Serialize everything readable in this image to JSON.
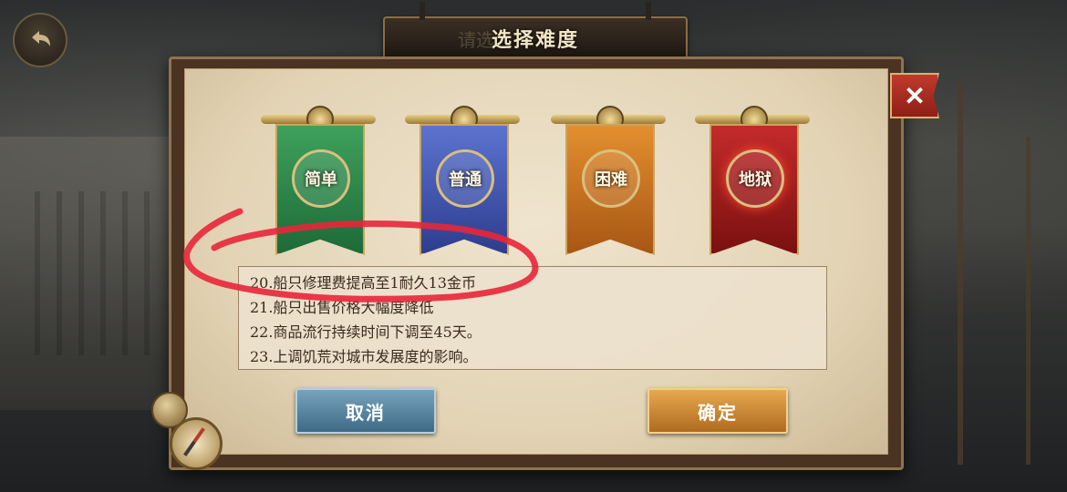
{
  "title": "选择难度",
  "title_ghost": "请选",
  "difficulties": [
    {
      "label": "简单",
      "color": "#2f8a4d"
    },
    {
      "label": "普通",
      "color": "#4a5fb8"
    },
    {
      "label": "困难",
      "color": "#d07a24"
    },
    {
      "label": "地狱",
      "color": "#a81f1f"
    }
  ],
  "description_lines": [
    "20.船只修理费提高至1耐久13金币",
    "21.船只出售价格大幅度降低",
    "22.商品流行持续时间下调至45天。",
    "23.上调饥荒对城市发展度的影响。"
  ],
  "buttons": {
    "cancel": "取消",
    "confirm": "确定"
  },
  "close_label": "✕",
  "icons": {
    "back": "back-arrow-icon",
    "close": "close-icon",
    "compass": "compass-icon"
  },
  "annotation_color": "#e8263a"
}
